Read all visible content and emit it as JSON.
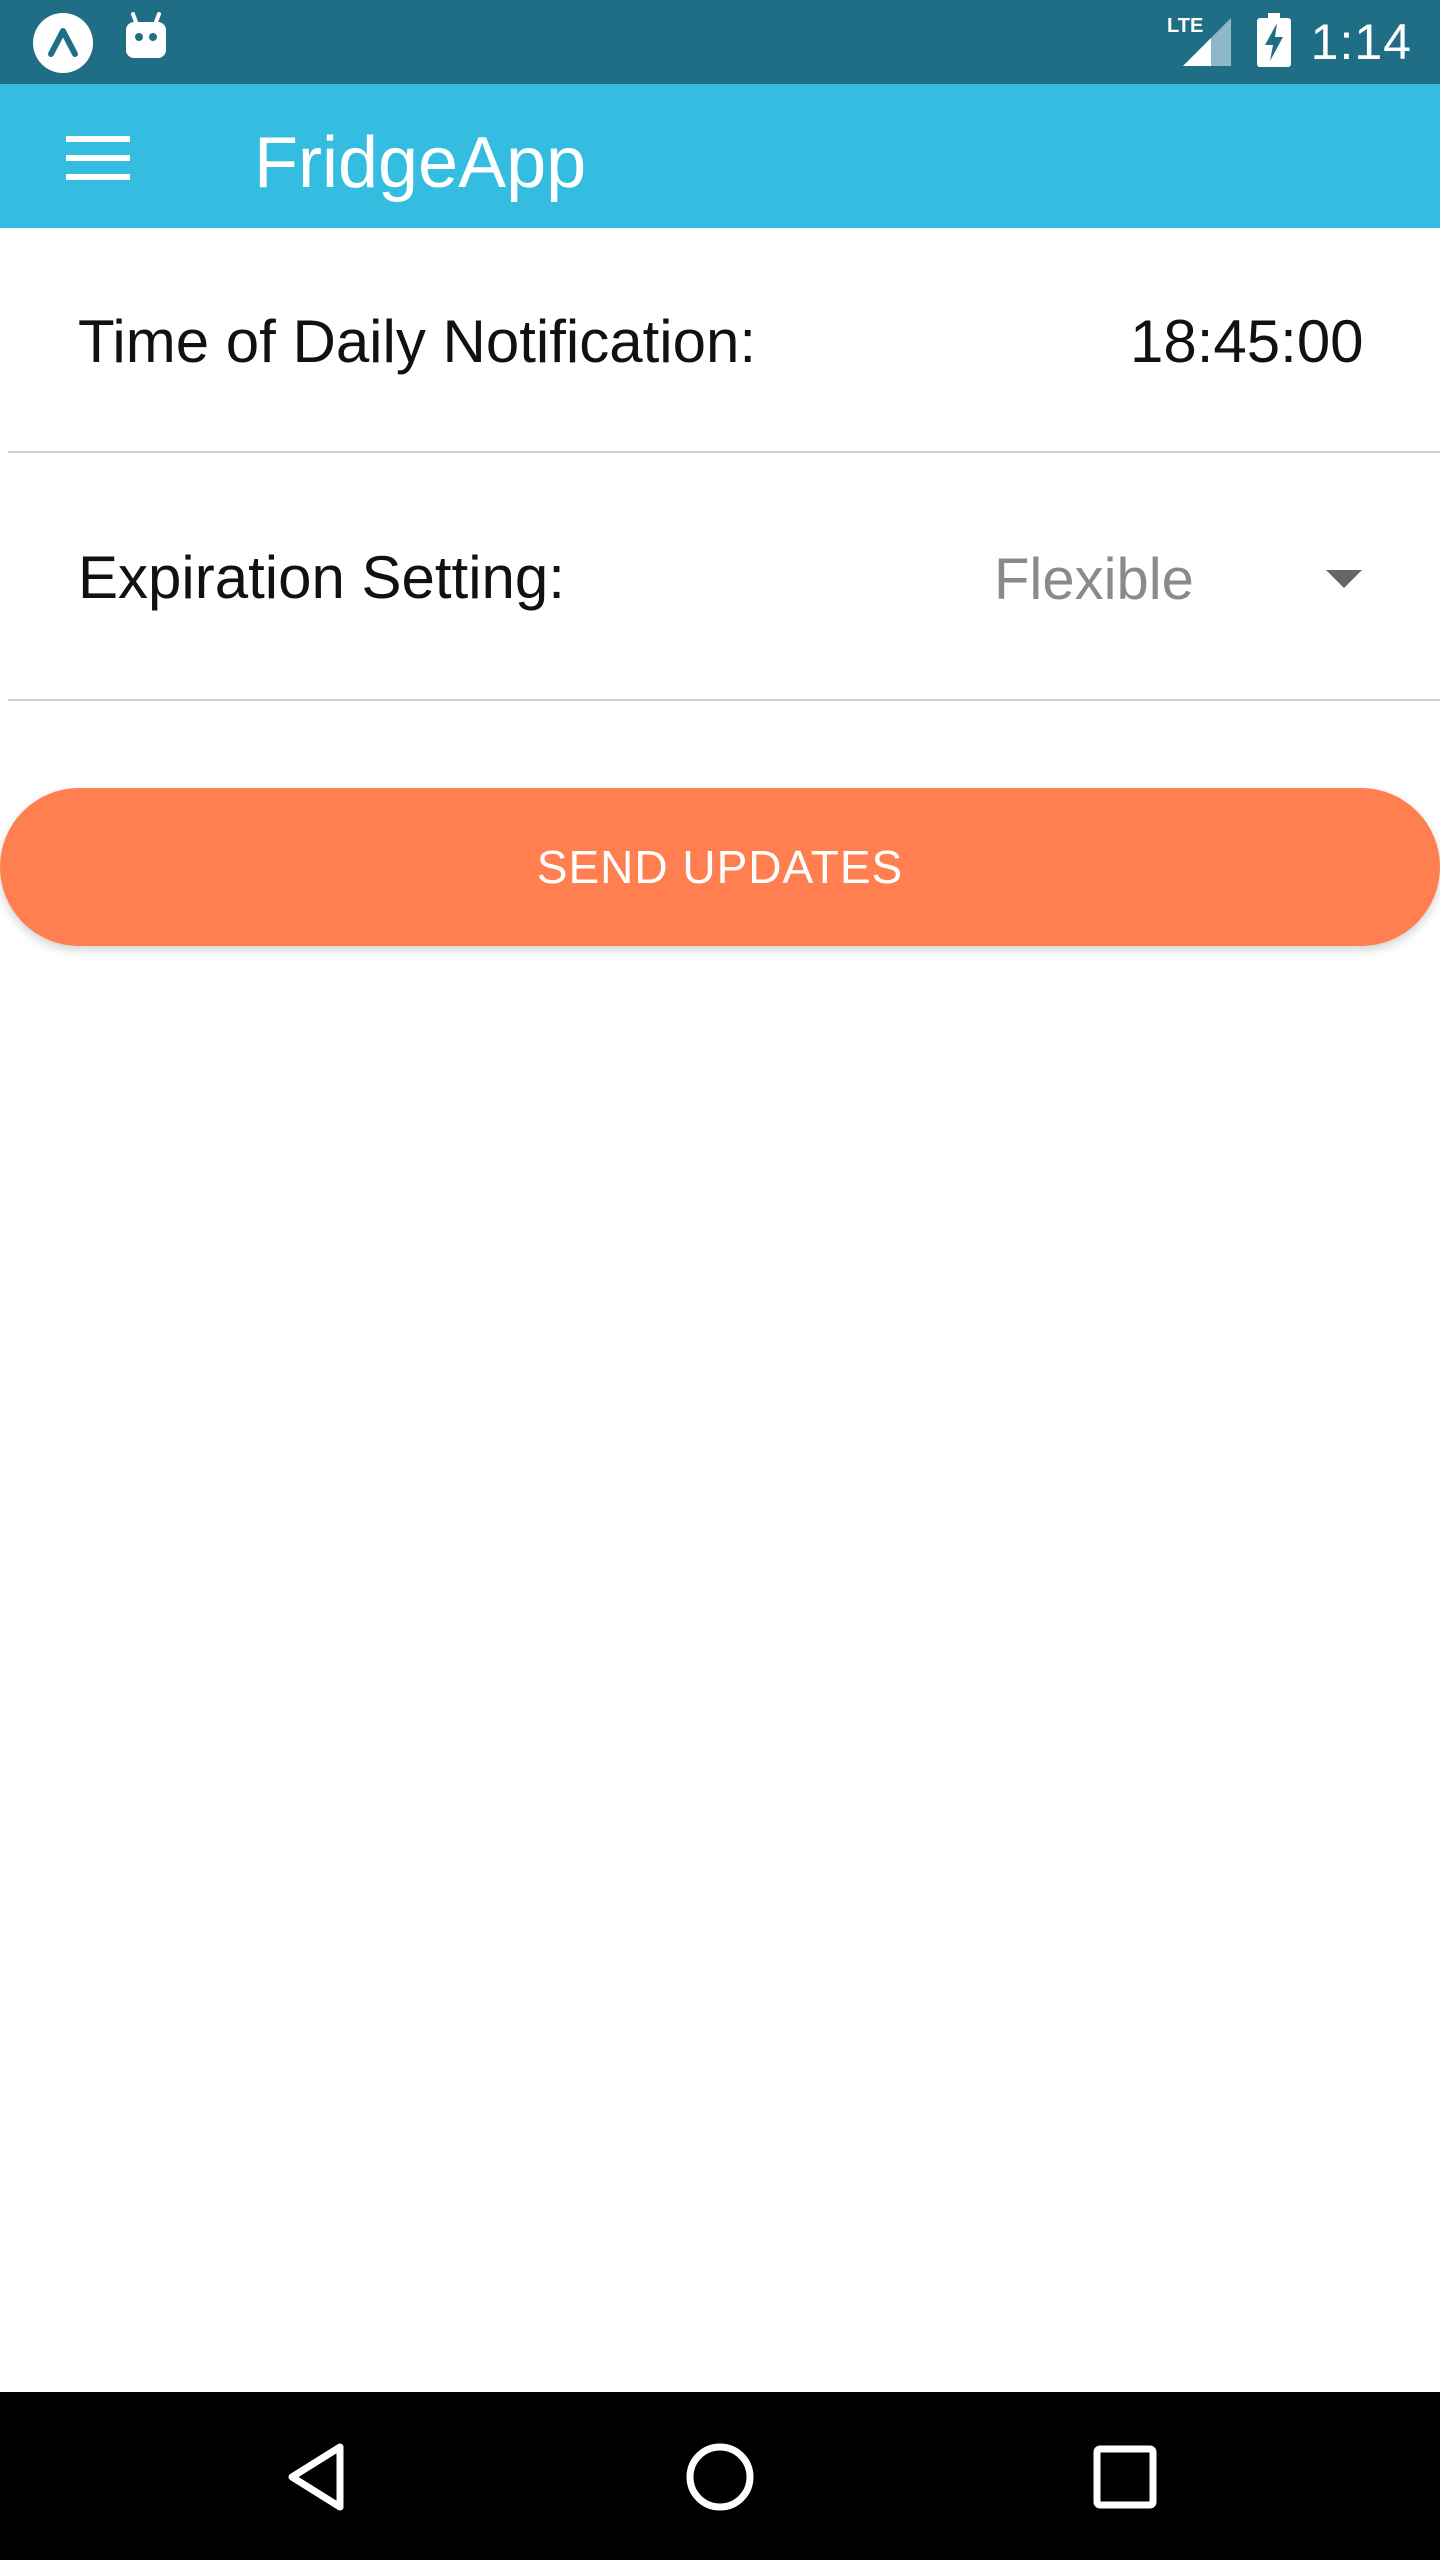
{
  "status_bar": {
    "time": "1:14",
    "network_label": "LTE",
    "icons": [
      "expo-app-icon",
      "android-notification-icon",
      "lte-signal-icon",
      "battery-charging-icon"
    ]
  },
  "app_bar": {
    "title": "FridgeApp",
    "menu_icon": "hamburger-menu-icon"
  },
  "settings": {
    "notification_time": {
      "label": "Time of Daily Notification:",
      "value": "18:45:00"
    },
    "expiration_setting": {
      "label": "Expiration Setting:",
      "selected": "Flexible",
      "icon": "dropdown-caret-icon"
    }
  },
  "actions": {
    "send_updates_label": "SEND UPDATES"
  },
  "nav_bar": {
    "icons": [
      "back-triangle-icon",
      "home-circle-icon",
      "recents-square-icon"
    ]
  },
  "colors": {
    "status_bar": "#1f6e86",
    "app_bar": "#35bde1",
    "send_button": "#ff7f50",
    "divider": "#cfcfcf",
    "nav_bar": "#000000"
  }
}
